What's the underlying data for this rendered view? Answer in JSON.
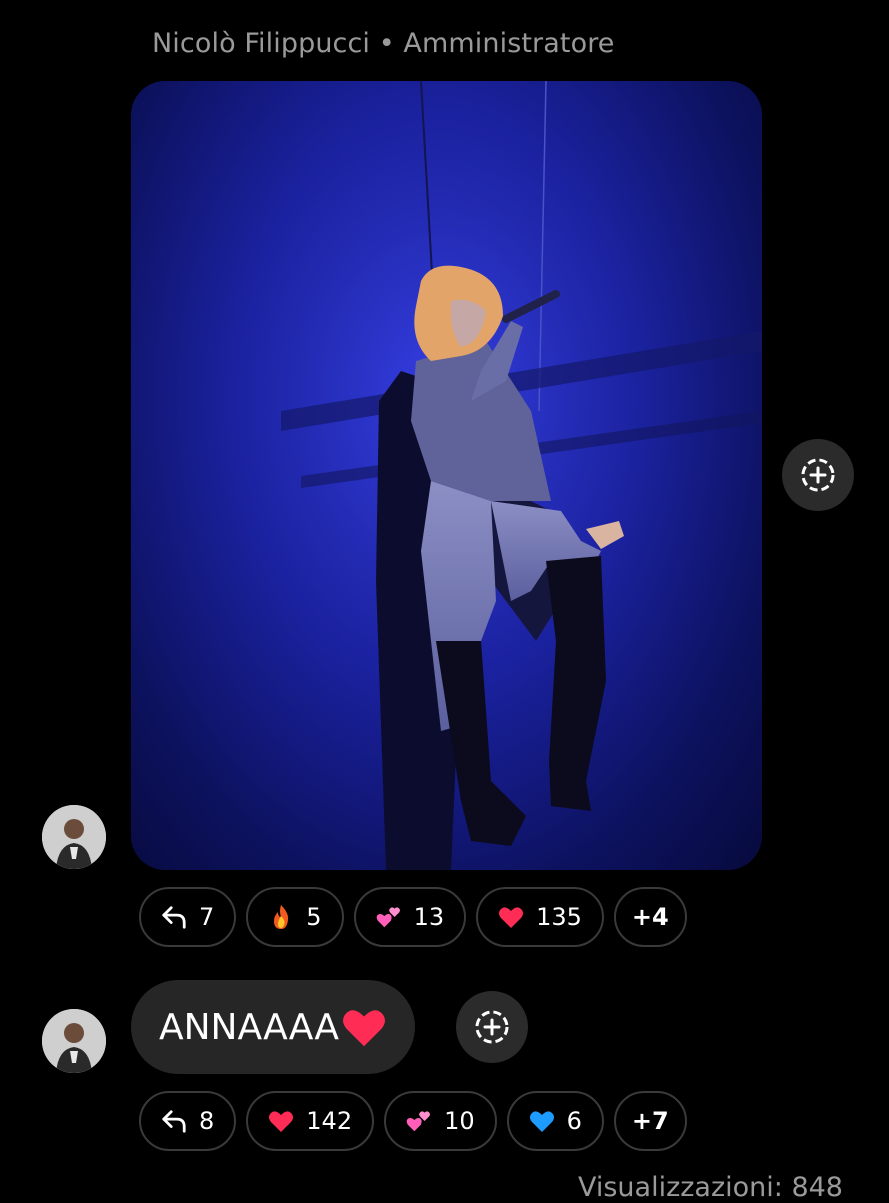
{
  "header": {
    "sender_line": "Nicolò Filippucci • Amministratore"
  },
  "post_photo": {
    "description": "Concert photo of performer on blue-lit stage"
  },
  "message_1": {
    "reactions": [
      {
        "icon": "reply-icon",
        "count": "7"
      },
      {
        "icon": "fire-emoji-icon",
        "count": "5"
      },
      {
        "icon": "two-hearts-emoji-icon",
        "count": "13"
      },
      {
        "icon": "red-heart-emoji-icon",
        "count": "135"
      }
    ],
    "more": "+4"
  },
  "message_2": {
    "text": "ANNAAAA",
    "reactions": [
      {
        "icon": "reply-icon",
        "count": "8"
      },
      {
        "icon": "red-heart-emoji-icon",
        "count": "142"
      },
      {
        "icon": "two-hearts-emoji-icon",
        "count": "10"
      },
      {
        "icon": "blue-heart-emoji-icon",
        "count": "6"
      }
    ],
    "more": "+7"
  },
  "footer": {
    "views": "Visualizzazioni: 848"
  },
  "colors": {
    "background": "#000000",
    "bubble": "#262626",
    "muted_text": "#9a9a9a",
    "chip_border": "#3a3a3a",
    "stage_blue": "#1b22a6"
  }
}
